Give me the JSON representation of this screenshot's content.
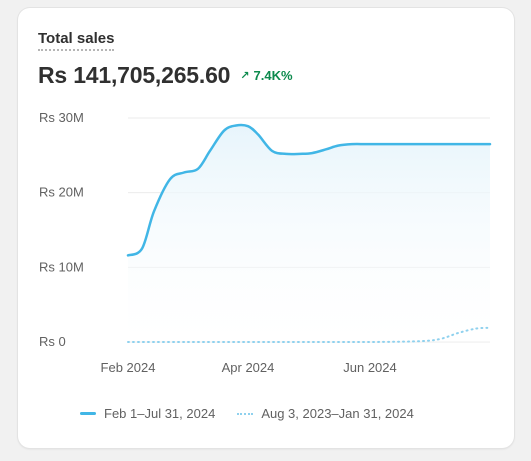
{
  "card": {
    "title": "Total sales",
    "value": "Rs 141,705,265.60",
    "change": "7.4K%",
    "change_icon": "arrow-up-right-icon",
    "change_color": "#0c8a4d"
  },
  "colors": {
    "current_series": "#41b6e6",
    "previous_series": "#8fd1ee",
    "area_fill_top": "#e6f4fb",
    "grid": "#ebebeb"
  },
  "chart_data": {
    "type": "line",
    "ylim": [
      0,
      30000000
    ],
    "yticks": [
      {
        "value": 0,
        "label": "Rs 0"
      },
      {
        "value": 10000000,
        "label": "Rs 10M"
      },
      {
        "value": 20000000,
        "label": "Rs 20M"
      },
      {
        "value": 30000000,
        "label": "Rs 30M"
      }
    ],
    "xlim": [
      "2024-02-01",
      "2024-07-31"
    ],
    "xticks": [
      {
        "date": "2024-02-01",
        "label": "Feb 2024"
      },
      {
        "date": "2024-04-01",
        "label": "Apr 2024"
      },
      {
        "date": "2024-06-01",
        "label": "Jun 2024"
      }
    ],
    "grid": true,
    "legend_position": "bottom",
    "series": [
      {
        "name": "Feb 1–Jul 31, 2024",
        "style": "solid",
        "area": true,
        "x": [
          "2024-02-01",
          "2024-02-08",
          "2024-02-14",
          "2024-02-22",
          "2024-02-29",
          "2024-03-07",
          "2024-03-13",
          "2024-03-20",
          "2024-03-26",
          "2024-04-01",
          "2024-04-06",
          "2024-04-13",
          "2024-04-20",
          "2024-04-27",
          "2024-05-03",
          "2024-05-10",
          "2024-05-16",
          "2024-05-23",
          "2024-05-31",
          "2024-06-15",
          "2024-07-01",
          "2024-07-15",
          "2024-07-31"
        ],
        "y": [
          11600000,
          12500000,
          17500000,
          21800000,
          22700000,
          23200000,
          25600000,
          28300000,
          29000000,
          28900000,
          27800000,
          25600000,
          25200000,
          25200000,
          25300000,
          25800000,
          26300000,
          26500000,
          26500000,
          26500000,
          26500000,
          26500000,
          26500000
        ]
      },
      {
        "name": "Aug 3, 2023–Jan 31, 2024",
        "style": "dotted",
        "area": false,
        "x": [
          "2024-02-01",
          "2024-03-01",
          "2024-04-01",
          "2024-05-01",
          "2024-06-01",
          "2024-06-25",
          "2024-07-06",
          "2024-07-15",
          "2024-07-24",
          "2024-07-31"
        ],
        "y": [
          0,
          0,
          0,
          0,
          0,
          100000,
          400000,
          1200000,
          1800000,
          1900000
        ]
      }
    ]
  }
}
